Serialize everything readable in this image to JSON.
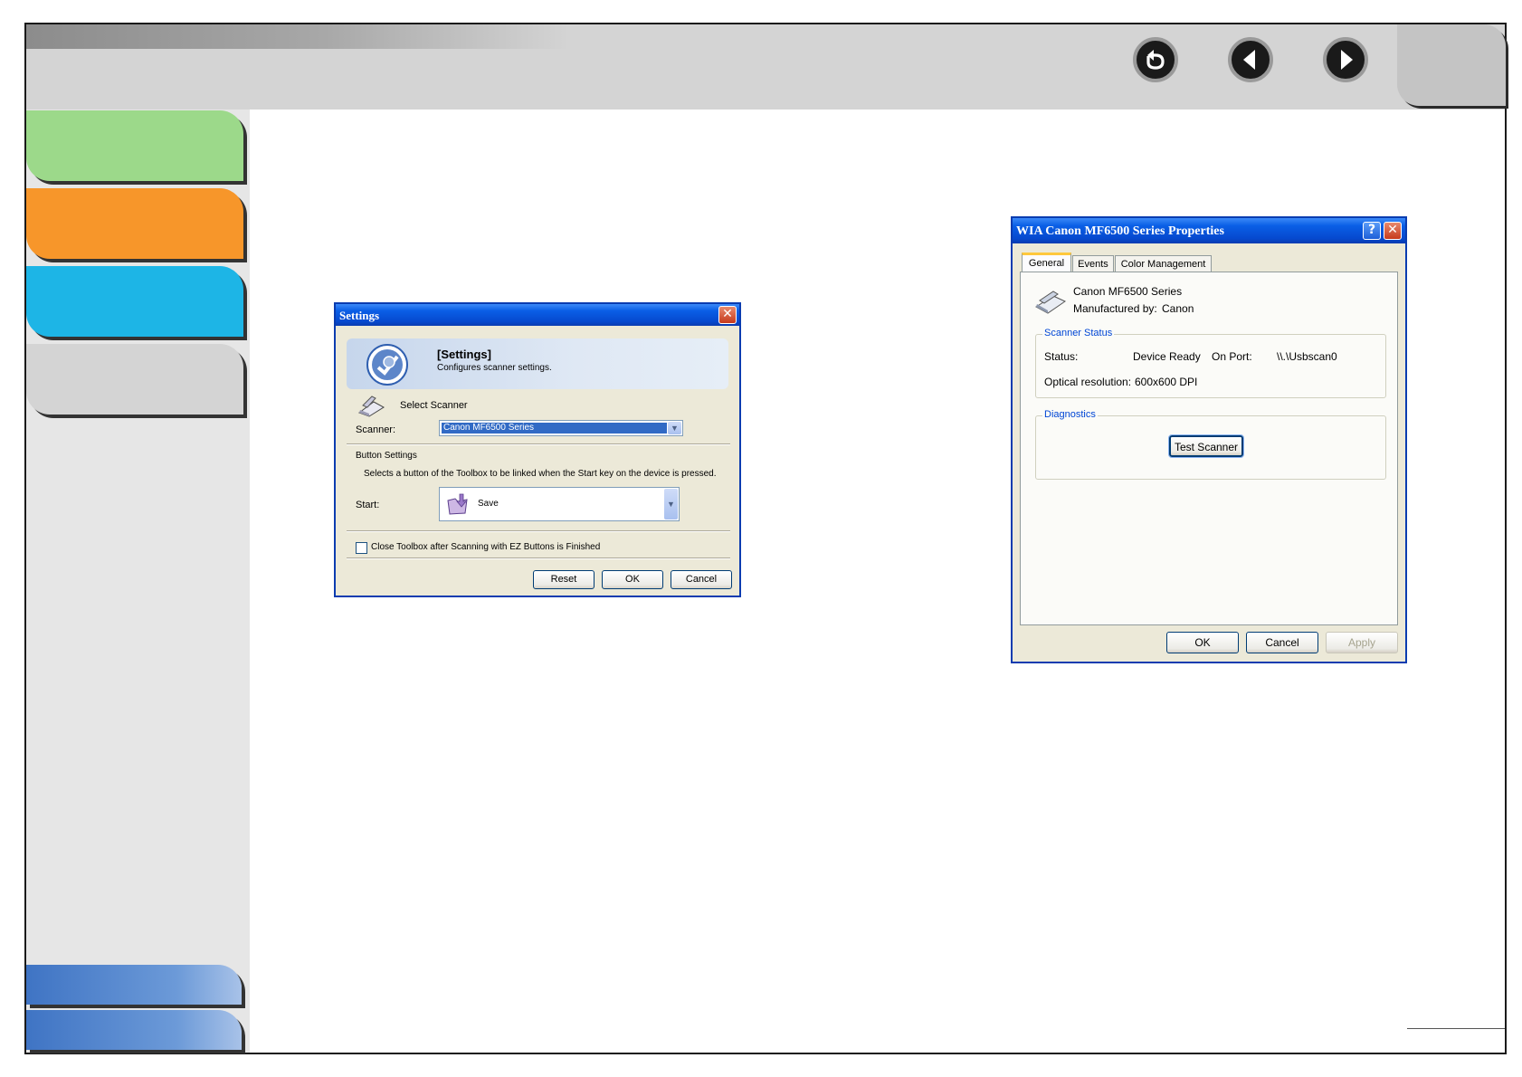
{
  "settings_dialog": {
    "title": "Settings",
    "close_glyph": "✕",
    "banner_title": "[Settings]",
    "banner_subtitle": "Configures scanner settings.",
    "select_scanner_label": "Select Scanner",
    "scanner_label": "Scanner:",
    "scanner_value": "Canon MF6500 Series",
    "button_settings_label": "Button Settings",
    "button_settings_desc": "Selects a button of the Toolbox to be linked when the Start key on the device is pressed.",
    "start_label": "Start:",
    "start_value": "Save",
    "close_toolbox_label": "Close Toolbox after Scanning with EZ Buttons is Finished",
    "close_toolbox_checked": false,
    "reset_label": "Reset",
    "ok_label": "OK",
    "cancel_label": "Cancel"
  },
  "properties_dialog": {
    "title": "WIA Canon MF6500 Series Properties",
    "help_glyph": "?",
    "close_glyph": "✕",
    "tabs": [
      "General",
      "Events",
      "Color Management"
    ],
    "active_tab": "General",
    "device_name": "Canon MF6500 Series",
    "manufactured_by_label": "Manufactured by:",
    "manufacturer": "Canon",
    "scanner_status_label": "Scanner Status",
    "status_label": "Status:",
    "status_value": "Device Ready",
    "on_port_label": "On Port:",
    "port_value": "\\\\.\\Usbscan0",
    "optical_resolution_label": "Optical resolution:",
    "optical_resolution_value": "600x600 DPI",
    "diagnostics_label": "Diagnostics",
    "test_scanner_label": "Test Scanner",
    "ok_label": "OK",
    "cancel_label": "Cancel",
    "apply_label": "Apply"
  },
  "colors": {
    "sidebar_tab_1": "#9cd98a",
    "sidebar_tab_2": "#f7962a",
    "sidebar_tab_3": "#1db5e6",
    "sidebar_tab_4": "#d4d4d4",
    "xp_title_blue": "#0649cf"
  },
  "icons": {
    "nav_back": "return-arrow-icon",
    "nav_prev": "left-triangle-icon",
    "nav_next": "right-triangle-icon"
  }
}
